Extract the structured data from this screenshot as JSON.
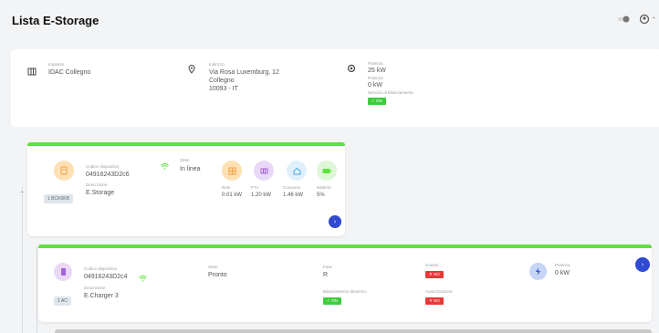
{
  "page": {
    "title": "Lista E-Storage"
  },
  "header": {
    "icons": [
      "toggle-icon",
      "user-icon"
    ]
  },
  "info": {
    "site": {
      "label": "Impianto",
      "value": "IDAC Collegno"
    },
    "address": {
      "label": "Indirizzo",
      "line1": "Via Rosa Luxemburg, 12",
      "line2": "Collegno",
      "line3": "10093 - IT"
    },
    "power": {
      "label1": "Potenza",
      "value1": "25 kW",
      "label2": "Potenza",
      "value2": "0 kW",
      "label3": "Servizio di bilanciamento",
      "status": "ON"
    }
  },
  "storage": {
    "tag": "1 BCK6KB",
    "code_label": "Codice dispositivo",
    "code": "04916243D2c6",
    "desc_label": "Descrizione",
    "desc": "E.Storage",
    "state_label": "Stato",
    "state": "In linea",
    "metrics": [
      {
        "label": "Rete",
        "value": "0.01 kW",
        "color": "#ffe0b5",
        "icon": "grid-icon"
      },
      {
        "label": "FTV",
        "value": "1.20 kW",
        "color": "#ead8f7",
        "icon": "solar-icon"
      },
      {
        "label": "Consumo",
        "value": "1.46 kW",
        "color": "#dff0fb",
        "icon": "home-icon"
      },
      {
        "label": "Batteria",
        "value": "5%",
        "color": "#def7d6",
        "icon": "battery-icon"
      }
    ]
  },
  "charger": {
    "tag": "1 AC",
    "code_label": "Codice dispositivo",
    "code": "04916243D2c4",
    "desc_label": "Descrizione",
    "desc": "E.Charger 3",
    "state_label": "Stato",
    "state": "Pronto",
    "phase_label": "Fase",
    "phase": "R",
    "fault_label": "Guasto",
    "fault": "NO",
    "balance_label": "Bilanciamento dinamico",
    "balance": "ON",
    "auth_label": "Autorizzazione",
    "auth": "NO",
    "power_label": "Potenza",
    "power": "0 kW"
  },
  "colors": {
    "green": "#5fe23a",
    "blue": "#2f49d1",
    "red": "#e53935"
  }
}
